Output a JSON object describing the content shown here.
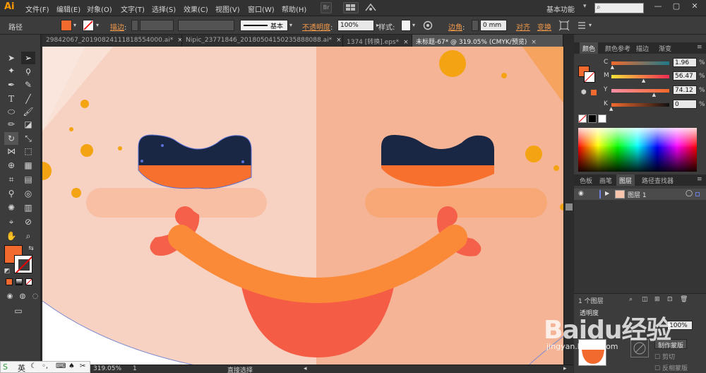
{
  "app": {
    "logo": "Ai"
  },
  "menubar": {
    "items": [
      "文件(F)",
      "编辑(E)",
      "对象(O)",
      "文字(T)",
      "选择(S)",
      "效果(C)",
      "视图(V)",
      "窗口(W)",
      "帮助(H)"
    ],
    "bridge": "Br",
    "workspace": "基本功能",
    "search_placeholder": ""
  },
  "controlbar": {
    "selection_type": "路径",
    "stroke_label": "描边",
    "stroke_style": "基本",
    "opacity_label": "不透明度",
    "opacity_value": "100%",
    "style_label": "样式",
    "corner_label": "边角",
    "corner_value": "0 mm",
    "align_label": "对齐",
    "transform_label": "变换",
    "fill_color": "#f26a2e"
  },
  "tabs": [
    {
      "label": "29842067_20190824111818554000.ai*",
      "active": false
    },
    {
      "label": "Nipic_23771846_20180504150235888088.ai*",
      "active": false
    },
    {
      "label": "1374 [转换].eps*",
      "active": false
    },
    {
      "label": "未标题-67* @ 319.05% (CMYK/预览)",
      "active": true
    }
  ],
  "tab_close": "×",
  "statusbar": {
    "zoom": "319.05%",
    "page": "1",
    "tool": "直接选择"
  },
  "ime": {
    "lang": "英"
  },
  "panels": {
    "color_tabs": [
      "颜色",
      "颜色参考",
      "描边",
      "渐变"
    ],
    "cmyk": [
      {
        "label": "C",
        "value": "1.96",
        "unit": "%",
        "fraction": 0.02
      },
      {
        "label": "M",
        "value": "56.47",
        "unit": "%",
        "fraction": 0.56
      },
      {
        "label": "Y",
        "value": "74.12",
        "unit": "%",
        "fraction": 0.74
      },
      {
        "label": "K",
        "value": "0",
        "unit": "%",
        "fraction": 0.0
      }
    ],
    "layer_tabs": [
      "色板",
      "画笔",
      "图层",
      "路径查找器"
    ],
    "layer_name": "图层 1",
    "layer_count": "1 个图层",
    "transparency_title": "透明度",
    "transparency_value": "100%",
    "make_mask": "制作蒙版",
    "clip": "剪切",
    "invert_mask": "反相蒙版"
  },
  "colors": {
    "face_left": "#f7d2c2",
    "face_right": "#f4b495",
    "eye_dark": "#1a2744",
    "eye_orange": "#f7702e",
    "smile": "#fa8a38",
    "mouth": "#f55c45",
    "cheek": "#f8b797",
    "dot": "#f4a312",
    "accent": "#f26a2e"
  },
  "watermark": {
    "text": "Baidu经验",
    "sub": "jingyan.baidu.com"
  }
}
